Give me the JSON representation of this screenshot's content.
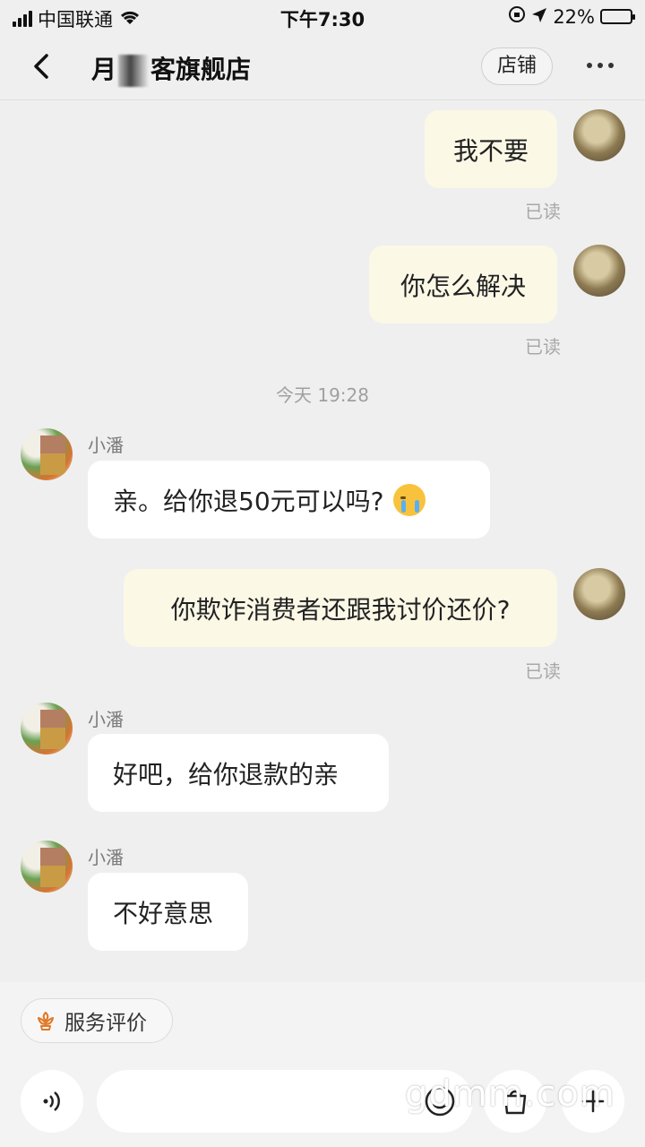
{
  "status_bar": {
    "carrier": "中国联通",
    "time": "下午7:30",
    "battery": "22%",
    "battery_level": 0.22,
    "icons": [
      "signal-icon",
      "wifi-icon",
      "rotation-lock-icon",
      "location-icon",
      "battery-icon"
    ]
  },
  "nav": {
    "title_prefix": "月",
    "title_suffix": "客旗舰店",
    "shop_button": "店铺",
    "icons": [
      "back-icon",
      "more-icon"
    ]
  },
  "messages": [
    {
      "from": "me",
      "text": "我不要",
      "status": "已读"
    },
    {
      "from": "me",
      "text": "你怎么解决",
      "status": "已读"
    },
    {
      "from": "me",
      "text": "你欺诈消费者还跟我讨价还价?",
      "status": "已读"
    }
  ],
  "timestamp": "今天 19:28",
  "seller_messages": [
    {
      "sender": "小潘",
      "text": "亲。给你退50元可以吗?"
    },
    {
      "sender": "小潘",
      "text": "好吧，给你退款的亲"
    },
    {
      "sender": "小潘",
      "text": "不好意思"
    }
  ],
  "bottom": {
    "service_chip": "服务评价",
    "input_placeholder": "",
    "icons": [
      "voice-icon",
      "emoji-icon",
      "product-icon",
      "plus-icon",
      "flower-icon"
    ]
  },
  "watermark": "gdmm.com",
  "colors": {
    "background": "#efefef",
    "my_bubble": "#fbf8e6",
    "their_bubble": "#ffffff",
    "read_text": "#a8a8a8"
  }
}
